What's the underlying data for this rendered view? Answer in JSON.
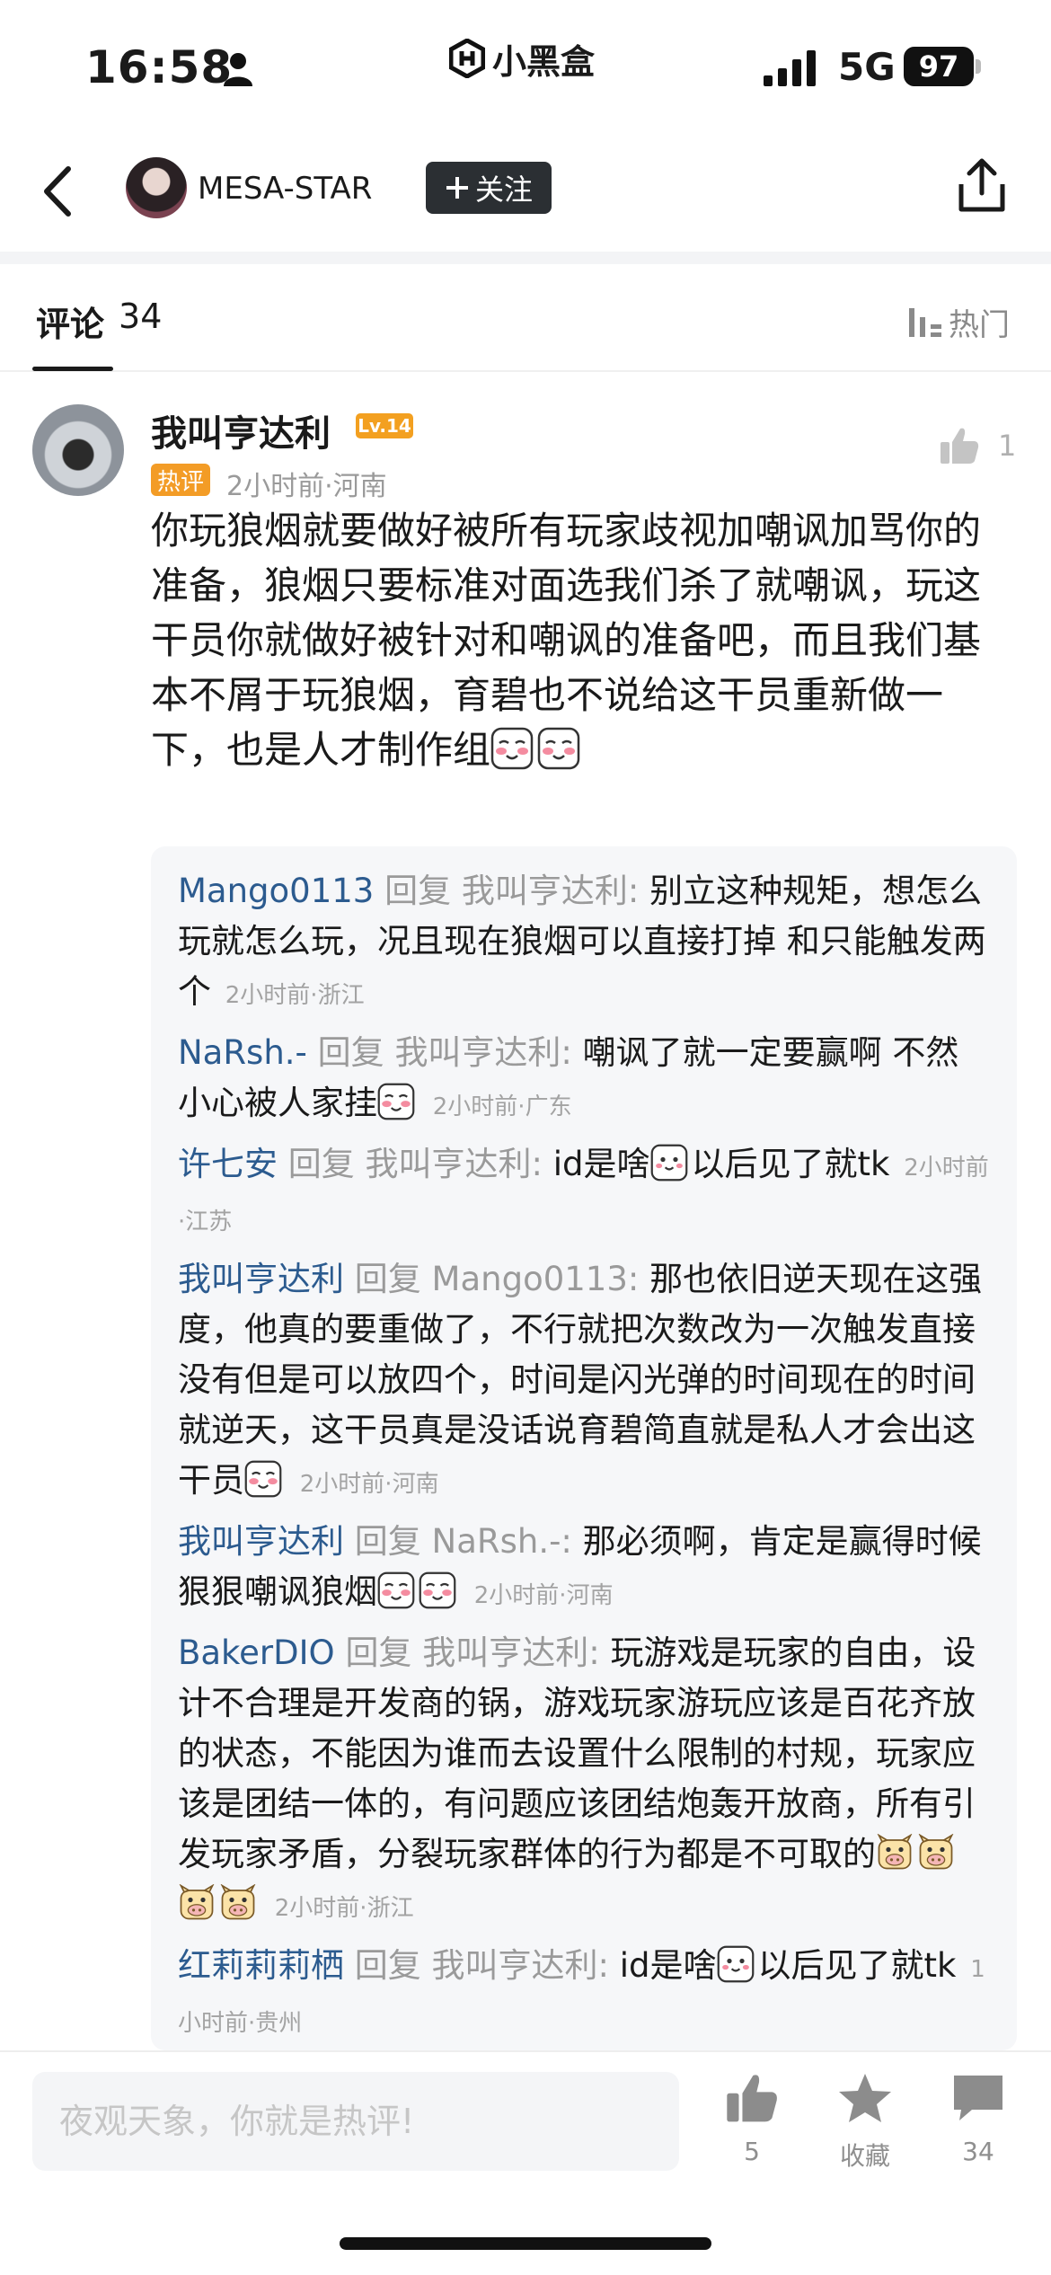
{
  "status_bar": {
    "time": "16:58",
    "app_brand": "小黑盒",
    "network": "5G",
    "battery": "97"
  },
  "header": {
    "username": "MESA-STAR",
    "follow_label": "关注"
  },
  "tabs": {
    "comments_label": "评论",
    "comments_count": "34",
    "sort_label": "热门"
  },
  "comment": {
    "author": "我叫亨达利",
    "level": "Lv.14",
    "hot_badge": "热评",
    "meta": "2小时前·河南",
    "likes": "1",
    "text": "你玩狼烟就要做好被所有玩家歧视加嘲讽加骂你的准备，狼烟只要标准对面选我们杀了就嘲讽，玩这干员你就做好被针对和嘲讽的准备吧，而且我们基本不屑于玩狼烟，育碧也不说给这干员重新做一下，也是人才制作组",
    "emojis": [
      "blush-emoji",
      "blush-emoji"
    ]
  },
  "replies": [
    {
      "name": "Mango0113",
      "verb": "回复",
      "target": "我叫亨达利:",
      "text": "别立这种规矩，想怎么玩就怎么玩，况且现在狼烟可以直接打掉 和只能触发两个",
      "emojis": [],
      "meta": "2小时前·浙江"
    },
    {
      "name": "NaRsh.-",
      "verb": "回复",
      "target": "我叫亨达利:",
      "text": "嘲讽了就一定要赢啊 不然小心被人家挂",
      "emojis": [
        "blush-emoji"
      ],
      "meta": "2小时前·广东"
    },
    {
      "name": "许七安",
      "verb": "回复",
      "target": "我叫亨达利:",
      "text": "id是啥",
      "text_after": "以后见了就tk",
      "emojis": [
        "smile-emoji"
      ],
      "meta": "2小时前·江苏"
    },
    {
      "name": "我叫亨达利",
      "verb": "回复",
      "target": "Mango0113:",
      "text": "那也依旧逆天现在这强度，他真的要重做了，不行就把次数改为一次触发直接没有但是可以放四个，时间是闪光弹的时间现在的时间就逆天，这干员真是没话说育碧简直就是私人才会出这干员",
      "emojis": [
        "blush-emoji"
      ],
      "meta": "2小时前·河南"
    },
    {
      "name": "我叫亨达利",
      "verb": "回复",
      "target": "NaRsh.-:",
      "text": "那必须啊，肯定是赢得时候狠狠嘲讽狼烟",
      "emojis": [
        "blush-emoji",
        "blush-emoji"
      ],
      "meta": "2小时前·河南"
    },
    {
      "name": "BakerDIO",
      "verb": "回复",
      "target": "我叫亨达利:",
      "text": "玩游戏是玩家的自由，设计不合理是开发商的锅，游戏玩家游玩应该是百花齐放的状态，不能因为谁而去设置什么限制的村规，玩家应该是团结一体的，有问题应该团结炮轰开放商，所有引发玩家矛盾，分裂玩家群体的行为都是不可取的",
      "emojis": [
        "cow-emoji",
        "cow-emoji",
        "cow-emoji",
        "cow-emoji"
      ],
      "meta": "2小时前·浙江"
    },
    {
      "name": "红莉莉莉栖",
      "verb": "回复",
      "target": "我叫亨达利:",
      "text": "id是啥",
      "text_after": "以后见了就tk",
      "emojis": [
        "smile-emoji"
      ],
      "meta": "1小时前·贵州"
    }
  ],
  "bottom_bar": {
    "input_placeholder": "夜观天象，你就是热评!",
    "like_count": "5",
    "favorite_label": "收藏",
    "comment_count": "34"
  }
}
